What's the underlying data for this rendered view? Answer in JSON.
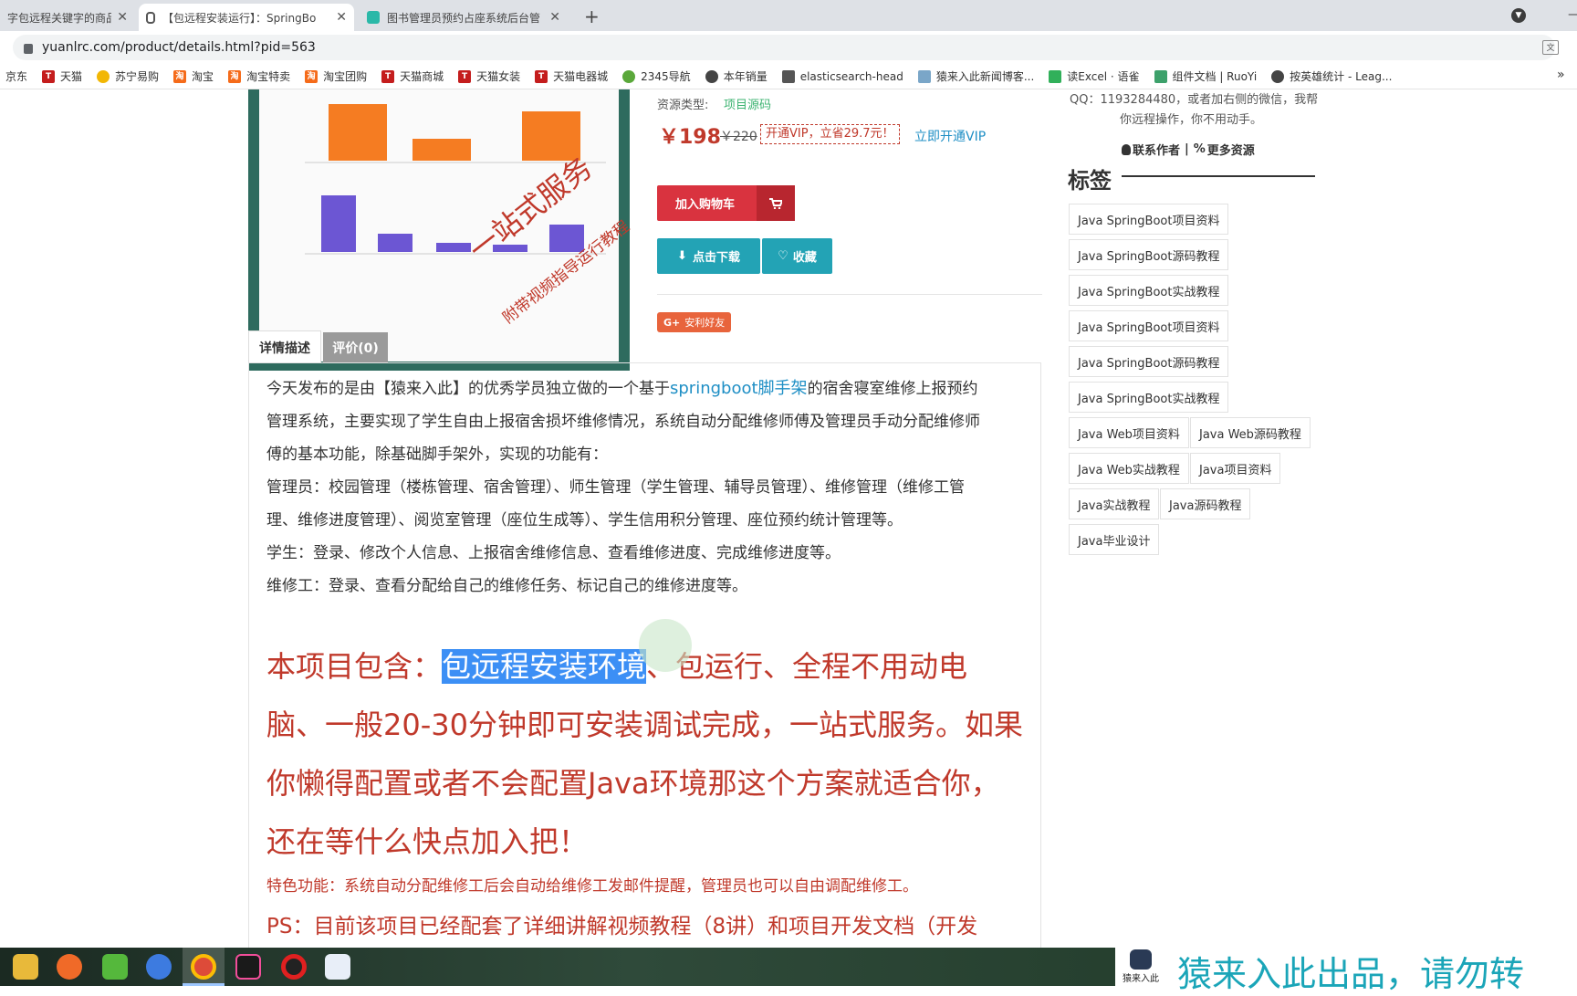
{
  "browser": {
    "tabs": [
      {
        "title": "字包远程关键字的商品 -",
        "active": false
      },
      {
        "title": "【包远程安装运行】：SpringBo",
        "active": true
      },
      {
        "title": "图书管理员预约占座系统后台管",
        "active": false
      }
    ],
    "new_tab": "+",
    "url": "yuanlrc.com/product/details.html?pid=563",
    "bookmarks": [
      "京东",
      "天猫",
      "苏宁易购",
      "淘宝",
      "淘宝特卖",
      "淘宝团购",
      "天猫商城",
      "天猫女装",
      "天猫电器城",
      "2345导航",
      "本年销量",
      "elasticsearch-head",
      "猿来入此新闻博客...",
      "读Excel · 语雀",
      "组件文档 | RuoYi",
      "按英雄统计 - Leag..."
    ],
    "more": "»"
  },
  "product": {
    "resource_label": "资源类型:",
    "resource_value": "项目源码",
    "price": "￥198",
    "old_price": "￥220",
    "vip_offer": "开通VIP，立省29.7元！",
    "vip_link": "立即开通VIP",
    "add_cart": "加入购物车",
    "download": "点击下载",
    "favorite": "收藏",
    "share": "安利好友",
    "image_overlay_1": "一站式服务",
    "image_overlay_2": "附带视频指导运行教程"
  },
  "tabs": {
    "detail": "详情描述",
    "review": "评价(0)"
  },
  "description": {
    "p1a": "今天发布的是由【猿来入此】的优秀学员独立做的一个基于",
    "p1link": "springboot脚手架",
    "p1b": "的宿舍寝室维修上报预约",
    "p2": "管理系统，主要实现了学生自由上报宿舍损坏维修情况，系统自动分配维修师傅及管理员手动分配维修师",
    "p3": "傅的基本功能，除基础脚手架外，实现的功能有：",
    "p4": "管理员：校园管理（楼栋管理、宿舍管理）、师生管理（学生管理、辅导员管理）、维修管理（维修工管",
    "p5": "理、维修进度管理）、阅览室管理（座位生成等）、学生信用积分管理、座位预约统计管理等。",
    "p6": "学生：登录、修改个人信息、上报宿舍维修信息、查看维修进度、完成维修进度等。",
    "p7": "维修工：登录、查看分配给自己的维修任务、标记自己的维修进度等。",
    "big1a": "本项目包含：",
    "big1hl": "包远程安装环境",
    "big1b": "、包运行、全程不用动电",
    "big2": "脑、一般20-30分钟即可安装调试完成，一站式服务。如果",
    "big3": "你懒得配置或者不会配置Java环境那这个方案就适合你，",
    "big4": "还在等什么快点加入把！",
    "feature": "特色功能：系统自动分配维修工后会自动给维修工发邮件提醒，管理员也可以自由调配维修工。",
    "ps": "PS：目前该项目已经配套了详细讲解视频教程（8讲）和项目开发文档（开发"
  },
  "sidebar": {
    "qq_line1": "QQ：1193284480，或者加右侧的微信，我帮",
    "qq_line2": "你远程操作，你不用动手。",
    "contact": "联系作者",
    "sep": "|",
    "more": "更多资源",
    "tags_title": "标签",
    "tags": [
      "Java SpringBoot项目资料",
      "Java SpringBoot源码教程",
      "Java SpringBoot实战教程",
      "Java SpringBoot项目资料",
      "Java SpringBoot源码教程",
      "Java SpringBoot实战教程",
      "Java Web项目资料",
      "Java Web源码教程",
      "Java Web实战教程",
      "Java项目资料",
      "Java实战教程",
      "Java源码教程",
      "Java毕业设计"
    ]
  },
  "watermark": {
    "logo": "猿来入此",
    "text": "猿来入此出品，请勿转"
  },
  "colors": {
    "price": "#c0392b",
    "cart": "#d9333f",
    "teal": "#23a3b5",
    "vip": "#1f8fc5",
    "source": "#3cb371",
    "highlight": "#3c8ff5"
  }
}
